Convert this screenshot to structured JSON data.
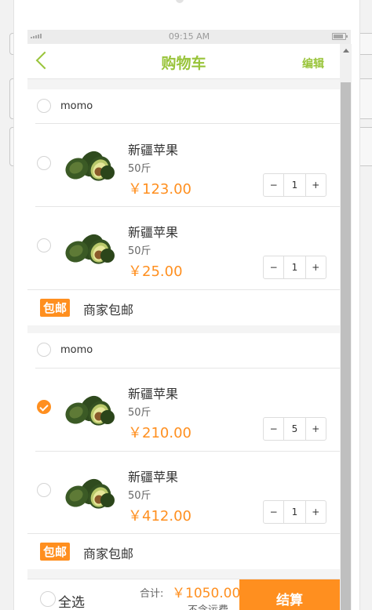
{
  "status": {
    "time": "09:15 AM"
  },
  "nav": {
    "title": "购物车",
    "edit": "编辑"
  },
  "shops": [
    {
      "name": "momo",
      "free_badge": "包邮",
      "free_text": "商家包邮",
      "items": [
        {
          "name": "新疆苹果",
          "weight": "50斤",
          "price": "￥123.00",
          "qty": "1",
          "checked": false
        },
        {
          "name": "新疆苹果",
          "weight": "50斤",
          "price": "￥25.00",
          "qty": "1",
          "checked": false
        }
      ]
    },
    {
      "name": "momo",
      "free_badge": "包邮",
      "free_text": "商家包邮",
      "items": [
        {
          "name": "新疆苹果",
          "weight": "50斤",
          "price": "￥210.00",
          "qty": "5",
          "checked": true
        },
        {
          "name": "新疆苹果",
          "weight": "50斤",
          "price": "￥412.00",
          "qty": "1",
          "checked": false
        }
      ]
    }
  ],
  "stepper": {
    "minus": "−",
    "plus": "+"
  },
  "footer": {
    "select_all": "全选",
    "total_label": "合计:",
    "total_value": "￥1050.00",
    "shipping_note": "不含运费",
    "checkout": "结算"
  },
  "colors": {
    "accent": "#99c43a",
    "price": "#ff8f1f"
  },
  "icons": {
    "back": "chevron-left-icon",
    "product": "avocado-image"
  }
}
